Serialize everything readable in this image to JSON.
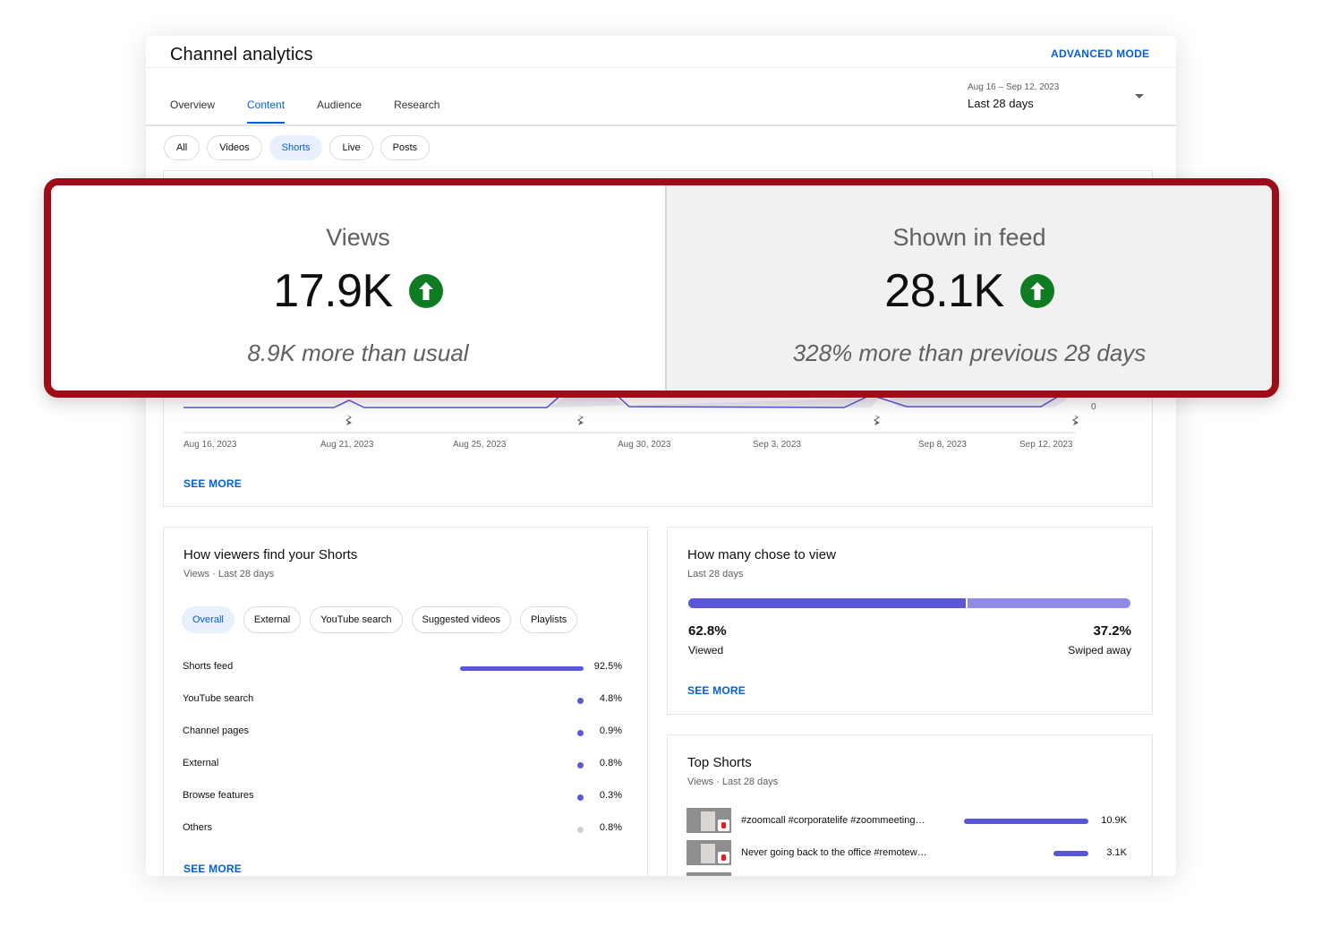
{
  "header": {
    "title": "Channel analytics",
    "advanced_mode": "ADVANCED MODE",
    "date_range": "Aug 16 – Sep 12, 2023",
    "date_label": "Last 28 days"
  },
  "tabs": [
    {
      "label": "Overview"
    },
    {
      "label": "Content"
    },
    {
      "label": "Audience"
    },
    {
      "label": "Research"
    }
  ],
  "active_tab": "Content",
  "filter_chips": [
    {
      "label": "All"
    },
    {
      "label": "Videos"
    },
    {
      "label": "Shorts"
    },
    {
      "label": "Live"
    },
    {
      "label": "Posts"
    }
  ],
  "active_filter": "Shorts",
  "metrics": {
    "views": {
      "label": "Views",
      "value": "17.9K",
      "note": "8.9K more than usual",
      "trend": "up"
    },
    "shown_in_feed": {
      "label": "Shown in feed",
      "value": "28.1K",
      "note": "328% more than previous 28 days",
      "trend": "up"
    }
  },
  "chart": {
    "y_tick_zero": "0",
    "x_ticks": [
      "Aug 16, 2023",
      "Aug 21, 2023",
      "Aug 25, 2023",
      "Aug 30, 2023",
      "Sep 3, 2023",
      "Sep 8, 2023",
      "Sep 12, 2023"
    ],
    "see_more": "SEE MORE",
    "marker_icon": "shorts-icon",
    "accent": "#5b56d6"
  },
  "traffic_sources": {
    "title": "How viewers find your Shorts",
    "subtitle": "Views · Last 28 days",
    "chips": [
      "Overall",
      "External",
      "YouTube search",
      "Suggested videos",
      "Playlists"
    ],
    "active_chip": "Overall",
    "rows": [
      {
        "name": "Shorts feed",
        "value": "92.5%",
        "fraction": 0.925
      },
      {
        "name": "YouTube search",
        "value": "4.8%",
        "fraction": 0.048
      },
      {
        "name": "Channel pages",
        "value": "0.9%",
        "fraction": 0.009
      },
      {
        "name": "External",
        "value": "0.8%",
        "fraction": 0.008
      },
      {
        "name": "Browse features",
        "value": "0.3%",
        "fraction": 0.003
      },
      {
        "name": "Others",
        "value": "0.8%",
        "fraction": 0.008
      }
    ],
    "see_more": "SEE MORE"
  },
  "chose_to_view": {
    "title": "How many chose to view",
    "subtitle": "Last 28 days",
    "viewed_pct": "62.8%",
    "viewed_label": "Viewed",
    "viewed_fraction": 0.628,
    "swiped_pct": "37.2%",
    "swiped_label": "Swiped away",
    "see_more": "SEE MORE"
  },
  "top_shorts": {
    "title": "Top Shorts",
    "subtitle": "Views · Last 28 days",
    "items": [
      {
        "title": "#zoomcall #corporatelife #zoommeeting…",
        "views": "10.9K",
        "fraction": 1.0
      },
      {
        "title": "Never going back to the office #remotew…",
        "views": "3.1K",
        "fraction": 0.284
      }
    ]
  },
  "colors": {
    "accent_blue": "#065fd4",
    "bar_purple": "#5b56d6",
    "trend_up_green": "#0f7b23",
    "highlight_border": "#9e0c17"
  }
}
